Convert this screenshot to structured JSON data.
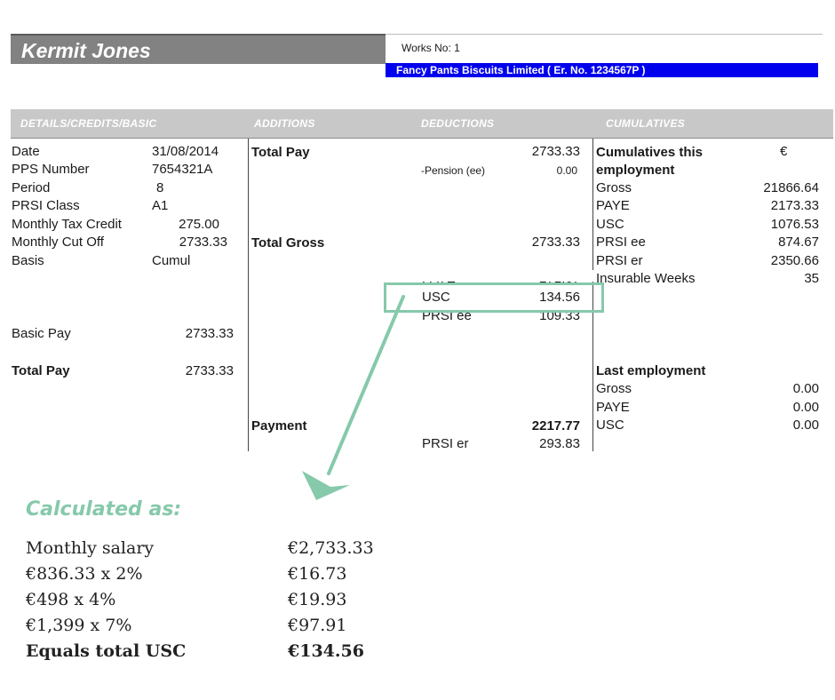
{
  "header": {
    "employee_name": "Kermit Jones",
    "works_no": "Works No: 1",
    "employer": "Fancy Pants Biscuits Limited  ( Er. No. 1234567P  )"
  },
  "sections": {
    "details": "DETAILS/CREDITS/BASIC",
    "additions": "ADDITIONS",
    "deductions": "DEDUCTIONS",
    "cumulatives": "CUMULATIVES"
  },
  "details": [
    {
      "label": "Date",
      "value": "31/08/2014"
    },
    {
      "label": "PPS Number",
      "value": "7654321A"
    },
    {
      "label": "Period",
      "value": "8"
    },
    {
      "label": "PRSI Class",
      "value": "A1"
    },
    {
      "label": "Monthly Tax Credit",
      "value": "275.00"
    },
    {
      "label": "Monthly Cut Off",
      "value": "2733.33"
    },
    {
      "label": "Basis",
      "value": "Cumul"
    }
  ],
  "basic_pay": {
    "label": "Basic Pay",
    "value": "2733.33"
  },
  "total_pay_left": {
    "label": "Total Pay",
    "value": "2733.33"
  },
  "additions": {
    "total_pay": "Total Pay",
    "total_gross": "Total Gross",
    "payment": "Payment"
  },
  "deductions": {
    "total_pay_value": "2733.33",
    "pension_label": "-Pension (ee)",
    "pension_value": "0.00",
    "total_gross_value": "2733.33",
    "items": [
      {
        "label": "PAYE",
        "value": "271.67"
      },
      {
        "label": "USC",
        "value": "134.56"
      },
      {
        "label": "PRSI ee",
        "value": "109.33"
      }
    ],
    "payment_value": "2217.77",
    "prsi_er_label": "PRSI er",
    "prsi_er_value": "293.83"
  },
  "cumulatives": {
    "title_line1": "Cumulatives this",
    "title_line2": "employment",
    "currency": "€",
    "items": [
      {
        "label": "Gross",
        "value": "21866.64"
      },
      {
        "label": "PAYE",
        "value": "2173.33"
      },
      {
        "label": "USC",
        "value": "1076.53"
      },
      {
        "label": "PRSI ee",
        "value": "874.67"
      },
      {
        "label": "PRSI er",
        "value": "2350.66"
      },
      {
        "label": "Insurable Weeks",
        "value": "35"
      }
    ],
    "last_title": "Last employment",
    "last_items": [
      {
        "label": "Gross",
        "value": "0.00"
      },
      {
        "label": "PAYE",
        "value": "0.00"
      },
      {
        "label": "USC",
        "value": "0.00"
      }
    ]
  },
  "calculation": {
    "title": "Calculated as:",
    "rows": [
      {
        "label": "Monthly salary",
        "value": "€2,733.33"
      },
      {
        "label": "€836.33 x 2%",
        "value": "€16.73"
      },
      {
        "label": "€498 x 4%",
        "value": "€19.93"
      },
      {
        "label": "€1,399 x 7%",
        "value": "€97.91"
      }
    ],
    "total": {
      "label": "Equals total USC",
      "value": "€134.56"
    }
  },
  "colors": {
    "accent": "#86c9ab",
    "employer_bar": "#0000ee",
    "name_bar": "#828282",
    "section_bar": "#c8c8c8"
  }
}
